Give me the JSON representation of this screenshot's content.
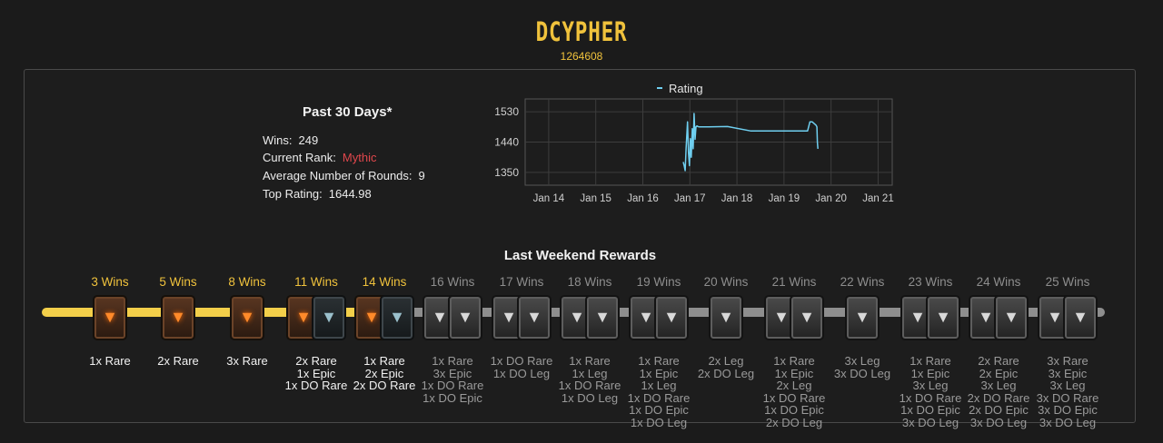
{
  "player": {
    "name": "DCYPHER",
    "id": "1264608"
  },
  "stats": {
    "title": "Past 30 Days*",
    "wins_label": "Wins:",
    "wins": "249",
    "rank_label": "Current Rank:",
    "rank": "Mythic",
    "rounds_label": "Average Number of Rounds:",
    "rounds": "9",
    "top_label": "Top Rating:",
    "top": "1644.98"
  },
  "chart_data": {
    "type": "line",
    "series": [
      {
        "name": "Rating",
        "color": "#6fcff0",
        "x": [
          16.86,
          16.88,
          16.9,
          16.92,
          16.95,
          16.97,
          16.99,
          17.01,
          17.03,
          17.05,
          17.07,
          17.09,
          17.11,
          17.13,
          17.15,
          17.17,
          17.2,
          17.4,
          17.8,
          18.3,
          18.6,
          19.0,
          19.3,
          19.5,
          19.55,
          19.6,
          19.68,
          19.7,
          19.71,
          19.72
        ],
        "y": [
          1381,
          1369,
          1355,
          1420,
          1500,
          1410,
          1370,
          1450,
          1395,
          1480,
          1420,
          1525,
          1448,
          1485,
          1488,
          1486,
          1485,
          1485,
          1486,
          1473,
          1473,
          1473,
          1473,
          1473,
          1500,
          1500,
          1490,
          1485,
          1440,
          1420
        ]
      }
    ],
    "xlim": [
      13.5,
      21.3
    ],
    "ylim": [
      1312,
      1568
    ],
    "xticks": [
      {
        "v": 14,
        "label": "Jan 14"
      },
      {
        "v": 15,
        "label": "Jan 15"
      },
      {
        "v": 16,
        "label": "Jan 16"
      },
      {
        "v": 17,
        "label": "Jan 17"
      },
      {
        "v": 18,
        "label": "Jan 18"
      },
      {
        "v": 19,
        "label": "Jan 19"
      },
      {
        "v": 20,
        "label": "Jan 20"
      },
      {
        "v": 21,
        "label": "Jan 21"
      }
    ],
    "yticks": [
      {
        "v": 1350,
        "label": "1350"
      },
      {
        "v": 1440,
        "label": "1440"
      },
      {
        "v": 1530,
        "label": "1530"
      }
    ],
    "grid": true,
    "legend_position": "top"
  },
  "rewards": {
    "title": "Last Weekend Rewards",
    "tiers": [
      {
        "label": "3 Wins",
        "done": true,
        "chests": [
          "rare"
        ],
        "items": [
          "1x Rare"
        ]
      },
      {
        "label": "5 Wins",
        "done": true,
        "chests": [
          "rare"
        ],
        "items": [
          "2x Rare"
        ]
      },
      {
        "label": "8 Wins",
        "done": true,
        "chests": [
          "rare"
        ],
        "items": [
          "3x Rare"
        ]
      },
      {
        "label": "11 Wins",
        "done": true,
        "chests": [
          "rare",
          "do"
        ],
        "items": [
          "2x Rare",
          "1x Epic",
          "1x DO Rare"
        ]
      },
      {
        "label": "14 Wins",
        "done": true,
        "chests": [
          "rare",
          "do"
        ],
        "items": [
          "1x Rare",
          "2x Epic",
          "2x DO Rare"
        ]
      },
      {
        "label": "16 Wins",
        "done": false,
        "chests": [
          "dim",
          "dim"
        ],
        "items": [
          "1x Rare",
          "3x Epic",
          "1x DO Rare",
          "1x DO Epic"
        ]
      },
      {
        "label": "17 Wins",
        "done": false,
        "chests": [
          "dim",
          "dim"
        ],
        "items": [
          "1x DO Rare",
          "1x DO Leg"
        ]
      },
      {
        "label": "18 Wins",
        "done": false,
        "chests": [
          "dim",
          "dim"
        ],
        "items": [
          "1x Rare",
          "1x Leg",
          "1x DO Rare",
          "1x DO Leg"
        ]
      },
      {
        "label": "19 Wins",
        "done": false,
        "chests": [
          "dim",
          "dim"
        ],
        "items": [
          "1x Rare",
          "1x Epic",
          "1x Leg",
          "1x DO Rare",
          "1x DO Epic",
          "1x DO Leg"
        ]
      },
      {
        "label": "20 Wins",
        "done": false,
        "chests": [
          "dim"
        ],
        "items": [
          "2x Leg",
          "2x DO Leg"
        ]
      },
      {
        "label": "21 Wins",
        "done": false,
        "chests": [
          "dim",
          "dim"
        ],
        "items": [
          "1x Rare",
          "1x Epic",
          "2x Leg",
          "1x DO Rare",
          "1x DO Epic",
          "2x DO Leg"
        ]
      },
      {
        "label": "22 Wins",
        "done": false,
        "chests": [
          "dim"
        ],
        "items": [
          "3x Leg",
          "3x DO Leg"
        ]
      },
      {
        "label": "23 Wins",
        "done": false,
        "chests": [
          "dim",
          "dim"
        ],
        "items": [
          "1x Rare",
          "1x Epic",
          "3x Leg",
          "1x DO Rare",
          "1x DO Epic",
          "3x DO Leg"
        ]
      },
      {
        "label": "24 Wins",
        "done": false,
        "chests": [
          "dim",
          "dim"
        ],
        "items": [
          "2x Rare",
          "2x Epic",
          "3x Leg",
          "2x DO Rare",
          "2x DO Epic",
          "3x DO Leg"
        ]
      },
      {
        "label": "25 Wins",
        "done": false,
        "chests": [
          "dim",
          "dim"
        ],
        "items": [
          "3x Rare",
          "3x Epic",
          "3x Leg",
          "3x DO Rare",
          "3x DO Epic",
          "3x DO Leg"
        ]
      }
    ]
  }
}
